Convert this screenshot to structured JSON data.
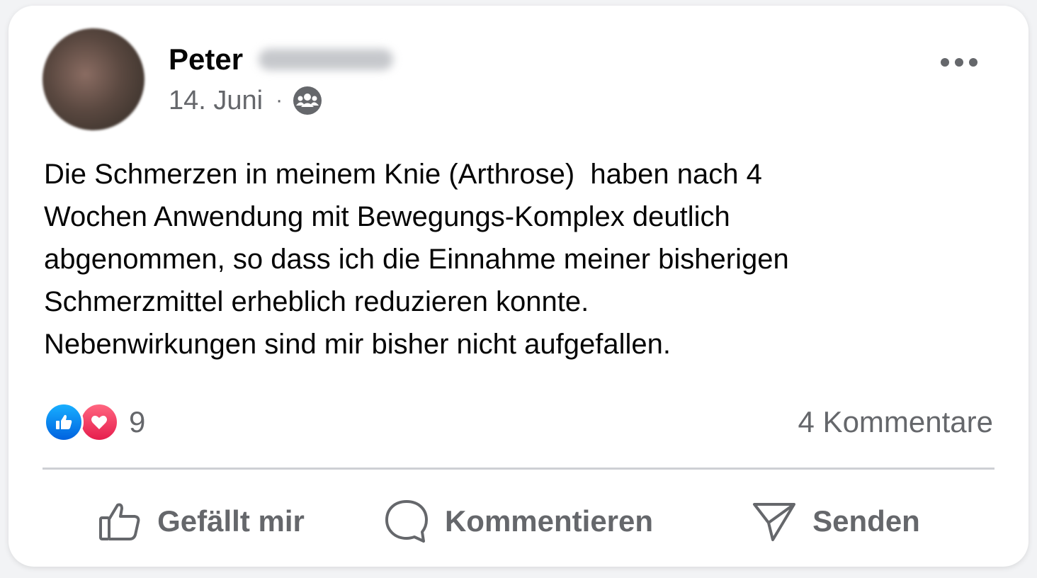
{
  "post": {
    "author_first_name": "Peter",
    "date": "14. Juni",
    "separator": "·",
    "audience_icon": "friends-icon",
    "body": "Die Schmerzen in meinem Knie (Arthrose)  haben nach 4\nWochen Anwendung mit Bewegungs-Komplex deutlich\nabgenommen, so dass ich die Einnahme meiner bisherigen\nSchmerzmittel erheblich reduzieren konnte.\nNebenwirkungen sind mir bisher nicht aufgefallen.",
    "reaction_count": "9",
    "comments_label": "4 Kommentare"
  },
  "actions": {
    "like_label": "Gefällt mir",
    "comment_label": "Kommentieren",
    "share_label": "Senden"
  },
  "colors": {
    "like_blue": "#0866ff",
    "love_red": "#f33e58",
    "secondary_text": "#65676b"
  }
}
